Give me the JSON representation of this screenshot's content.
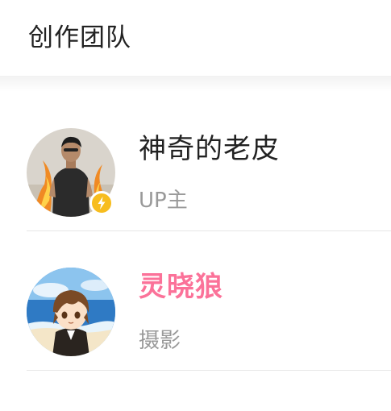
{
  "header": {
    "title": "创作团队"
  },
  "members": [
    {
      "name": "神奇的老皮",
      "role": "UP主",
      "name_color": "#222222",
      "verified": true,
      "badge_color": "#f7bd1f",
      "badge_icon": "lightning-bolt-icon",
      "avatar": "avatar-man-with-flames"
    },
    {
      "name": "灵晓狼",
      "role": "摄影",
      "name_color": "#fb7299",
      "verified": false,
      "avatar": "avatar-anime-boy-beach"
    }
  ],
  "colors": {
    "accent_pink": "#fb7299",
    "secondary_text": "#999999",
    "divider": "#e7e7e7"
  }
}
